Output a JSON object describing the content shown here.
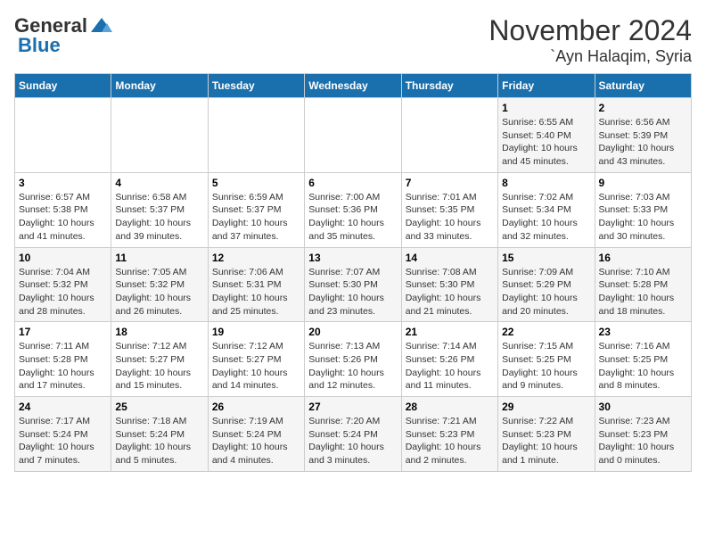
{
  "header": {
    "logo_general": "General",
    "logo_blue": "Blue",
    "month": "November 2024",
    "location": "`Ayn Halaqim, Syria"
  },
  "weekdays": [
    "Sunday",
    "Monday",
    "Tuesday",
    "Wednesday",
    "Thursday",
    "Friday",
    "Saturday"
  ],
  "weeks": [
    [
      {
        "day": "",
        "info": ""
      },
      {
        "day": "",
        "info": ""
      },
      {
        "day": "",
        "info": ""
      },
      {
        "day": "",
        "info": ""
      },
      {
        "day": "",
        "info": ""
      },
      {
        "day": "1",
        "info": "Sunrise: 6:55 AM\nSunset: 5:40 PM\nDaylight: 10 hours and 45 minutes."
      },
      {
        "day": "2",
        "info": "Sunrise: 6:56 AM\nSunset: 5:39 PM\nDaylight: 10 hours and 43 minutes."
      }
    ],
    [
      {
        "day": "3",
        "info": "Sunrise: 6:57 AM\nSunset: 5:38 PM\nDaylight: 10 hours and 41 minutes."
      },
      {
        "day": "4",
        "info": "Sunrise: 6:58 AM\nSunset: 5:37 PM\nDaylight: 10 hours and 39 minutes."
      },
      {
        "day": "5",
        "info": "Sunrise: 6:59 AM\nSunset: 5:37 PM\nDaylight: 10 hours and 37 minutes."
      },
      {
        "day": "6",
        "info": "Sunrise: 7:00 AM\nSunset: 5:36 PM\nDaylight: 10 hours and 35 minutes."
      },
      {
        "day": "7",
        "info": "Sunrise: 7:01 AM\nSunset: 5:35 PM\nDaylight: 10 hours and 33 minutes."
      },
      {
        "day": "8",
        "info": "Sunrise: 7:02 AM\nSunset: 5:34 PM\nDaylight: 10 hours and 32 minutes."
      },
      {
        "day": "9",
        "info": "Sunrise: 7:03 AM\nSunset: 5:33 PM\nDaylight: 10 hours and 30 minutes."
      }
    ],
    [
      {
        "day": "10",
        "info": "Sunrise: 7:04 AM\nSunset: 5:32 PM\nDaylight: 10 hours and 28 minutes."
      },
      {
        "day": "11",
        "info": "Sunrise: 7:05 AM\nSunset: 5:32 PM\nDaylight: 10 hours and 26 minutes."
      },
      {
        "day": "12",
        "info": "Sunrise: 7:06 AM\nSunset: 5:31 PM\nDaylight: 10 hours and 25 minutes."
      },
      {
        "day": "13",
        "info": "Sunrise: 7:07 AM\nSunset: 5:30 PM\nDaylight: 10 hours and 23 minutes."
      },
      {
        "day": "14",
        "info": "Sunrise: 7:08 AM\nSunset: 5:30 PM\nDaylight: 10 hours and 21 minutes."
      },
      {
        "day": "15",
        "info": "Sunrise: 7:09 AM\nSunset: 5:29 PM\nDaylight: 10 hours and 20 minutes."
      },
      {
        "day": "16",
        "info": "Sunrise: 7:10 AM\nSunset: 5:28 PM\nDaylight: 10 hours and 18 minutes."
      }
    ],
    [
      {
        "day": "17",
        "info": "Sunrise: 7:11 AM\nSunset: 5:28 PM\nDaylight: 10 hours and 17 minutes."
      },
      {
        "day": "18",
        "info": "Sunrise: 7:12 AM\nSunset: 5:27 PM\nDaylight: 10 hours and 15 minutes."
      },
      {
        "day": "19",
        "info": "Sunrise: 7:12 AM\nSunset: 5:27 PM\nDaylight: 10 hours and 14 minutes."
      },
      {
        "day": "20",
        "info": "Sunrise: 7:13 AM\nSunset: 5:26 PM\nDaylight: 10 hours and 12 minutes."
      },
      {
        "day": "21",
        "info": "Sunrise: 7:14 AM\nSunset: 5:26 PM\nDaylight: 10 hours and 11 minutes."
      },
      {
        "day": "22",
        "info": "Sunrise: 7:15 AM\nSunset: 5:25 PM\nDaylight: 10 hours and 9 minutes."
      },
      {
        "day": "23",
        "info": "Sunrise: 7:16 AM\nSunset: 5:25 PM\nDaylight: 10 hours and 8 minutes."
      }
    ],
    [
      {
        "day": "24",
        "info": "Sunrise: 7:17 AM\nSunset: 5:24 PM\nDaylight: 10 hours and 7 minutes."
      },
      {
        "day": "25",
        "info": "Sunrise: 7:18 AM\nSunset: 5:24 PM\nDaylight: 10 hours and 5 minutes."
      },
      {
        "day": "26",
        "info": "Sunrise: 7:19 AM\nSunset: 5:24 PM\nDaylight: 10 hours and 4 minutes."
      },
      {
        "day": "27",
        "info": "Sunrise: 7:20 AM\nSunset: 5:24 PM\nDaylight: 10 hours and 3 minutes."
      },
      {
        "day": "28",
        "info": "Sunrise: 7:21 AM\nSunset: 5:23 PM\nDaylight: 10 hours and 2 minutes."
      },
      {
        "day": "29",
        "info": "Sunrise: 7:22 AM\nSunset: 5:23 PM\nDaylight: 10 hours and 1 minute."
      },
      {
        "day": "30",
        "info": "Sunrise: 7:23 AM\nSunset: 5:23 PM\nDaylight: 10 hours and 0 minutes."
      }
    ]
  ]
}
